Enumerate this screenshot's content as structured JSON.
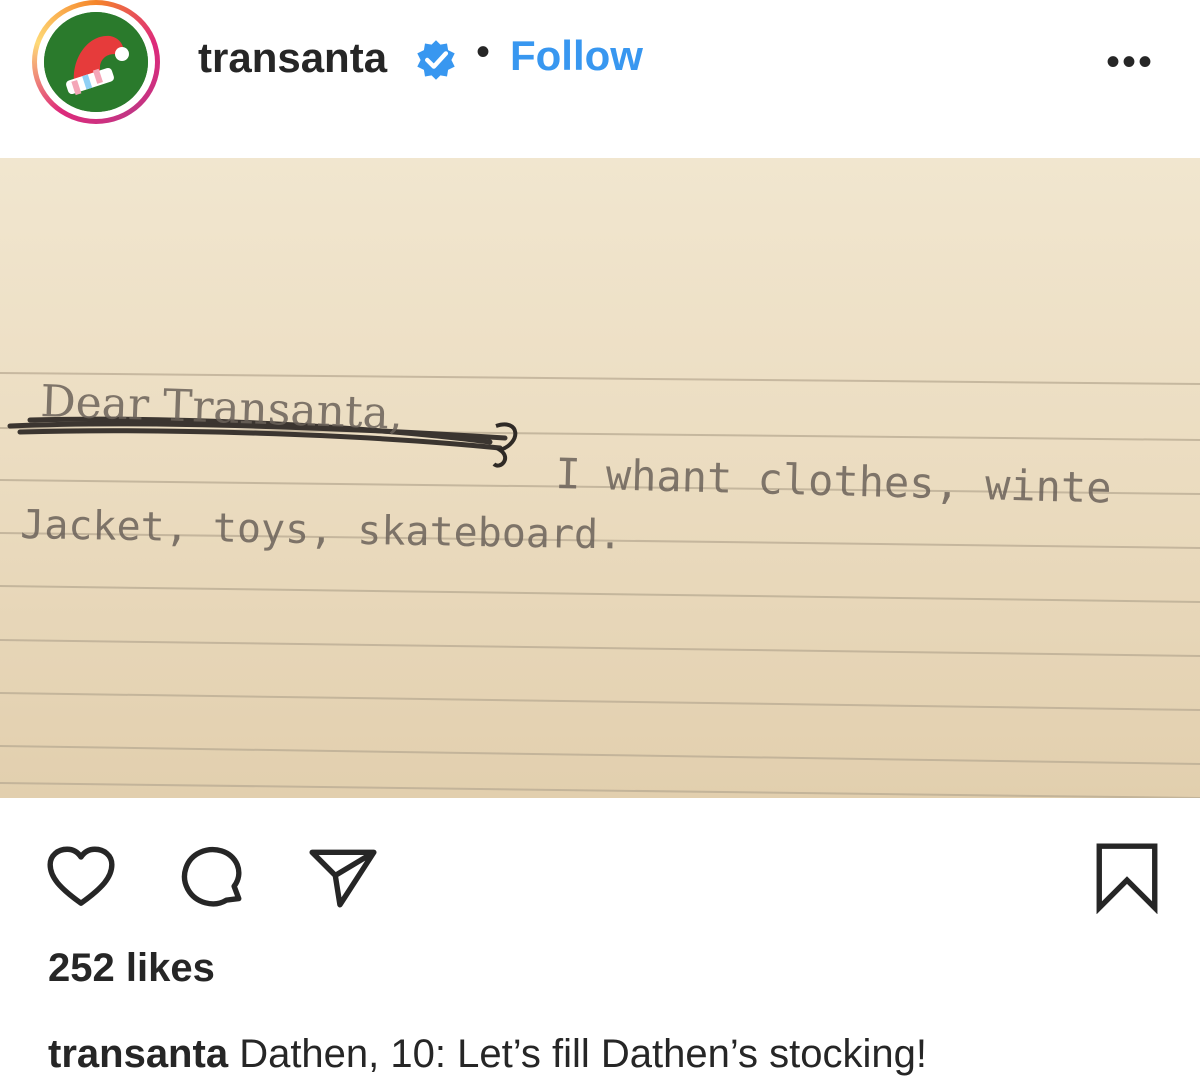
{
  "post": {
    "username": "transanta",
    "verified": true,
    "separator": "•",
    "follow_label": "Follow",
    "more_label": "•••",
    "avatar_icon": "santa-hat-icon",
    "colors": {
      "follow_blue": "#3897f0",
      "verified_blue": "#3897f0",
      "avatar_green": "#2a7a2c",
      "text": "#262626"
    }
  },
  "photo": {
    "handwritten_lines": [
      "Dear Transanta,",
      "I whant clothes, winte",
      "Jacket, toys, skateboard."
    ]
  },
  "actions": {
    "like_icon": "heart-icon",
    "comment_icon": "comment-icon",
    "share_icon": "paper-plane-icon",
    "save_icon": "bookmark-icon"
  },
  "likes": {
    "text": "252 likes"
  },
  "caption": {
    "username": "transanta",
    "text": "Dathen, 10: Let’s fill Dathen’s stocking!"
  }
}
